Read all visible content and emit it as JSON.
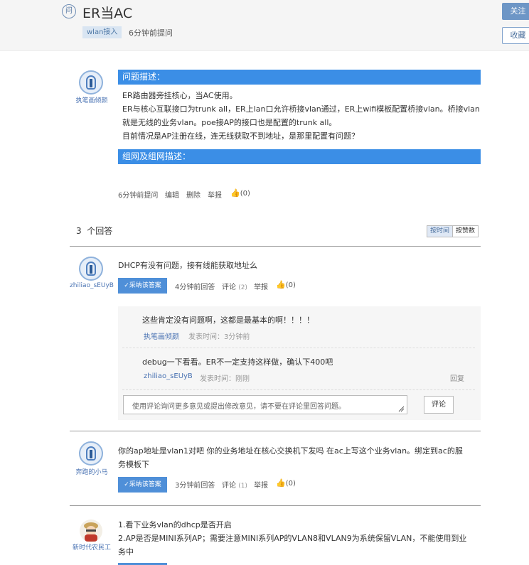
{
  "question": {
    "badge": "问",
    "title": "ER当AC",
    "tag": "wlan接入",
    "time": "6分钟前提问",
    "follow_label": "关注",
    "collect_label": "收藏",
    "author": "执笔画倾颜",
    "section_problem": "问题描述：",
    "description": [
      "ER路由器旁挂核心，当AC使用。",
      "ER与核心互联接口为trunk all，ER上lan口允许桥接vlan通过，ER上wifi模板配置桥接vlan。桥接vlan",
      "就是无线的业务vlan。poe接AP的接口也是配置的trunk all。",
      "目前情况是AP注册在线，连无线获取不到地址，是那里配置有问题？"
    ],
    "section_network": "组网及组网描述：",
    "meta": {
      "time": "6分钟前提问",
      "edit": "编辑",
      "delete": "删除",
      "report": "举报",
      "likes": "(0)"
    }
  },
  "answers_header": {
    "count": "3",
    "label": "个回答",
    "sort_time": "按时间",
    "sort_likes": "按赞数"
  },
  "answers": [
    {
      "author": "zhiliao_sEUyB",
      "text": "DHCP有没有问题，接有线能获取地址么",
      "accept_label": "✓采纳该答案",
      "time": "4分钟前回答",
      "comment_label": "评论",
      "comment_count": "(2)",
      "report": "举报",
      "likes": "(0)",
      "comments": [
        {
          "text": "这些肯定没有问题啊，这都是最基本的啊！！！！",
          "user": "执笔画倾颜",
          "time": "发表时间：3分钟前"
        },
        {
          "text": "debug一下看看。ER不一定支持这样做，确认下400吧",
          "user": "zhiliao_sEUyB",
          "time": "发表时间：刚刚",
          "reply": "回复"
        }
      ],
      "comment_placeholder": "使用评论询问更多意见或提出修改意见，请不要在评论里回答问题。",
      "comment_button": "评论"
    },
    {
      "author": "奔跑的小马",
      "text_lines": [
        "你的ap地址是vlan1对吧    你的业务地址在核心交换机下发吗  在ac上写这个业务vlan。绑定到ac的服",
        "务模板下"
      ],
      "accept_label": "✓采纳该答案",
      "time": "3分钟前回答",
      "comment_label": "评论",
      "comment_count": "(1)",
      "report": "举报",
      "likes": "(0)"
    },
    {
      "author": "新时代农民工",
      "text_lines": [
        "1.看下业务vlan的dhcp是否开启",
        "2.AP是否是MINI系列AP；需要注意MINI系列AP的VLAN8和VLAN9为系统保留VLAN，不能使用到业",
        "务中"
      ]
    }
  ],
  "colors": {
    "section_bar": "#3b8ee6",
    "accept_button": "#4f8fd8",
    "link": "#4a73b3",
    "follow_button": "#6d96c6"
  }
}
